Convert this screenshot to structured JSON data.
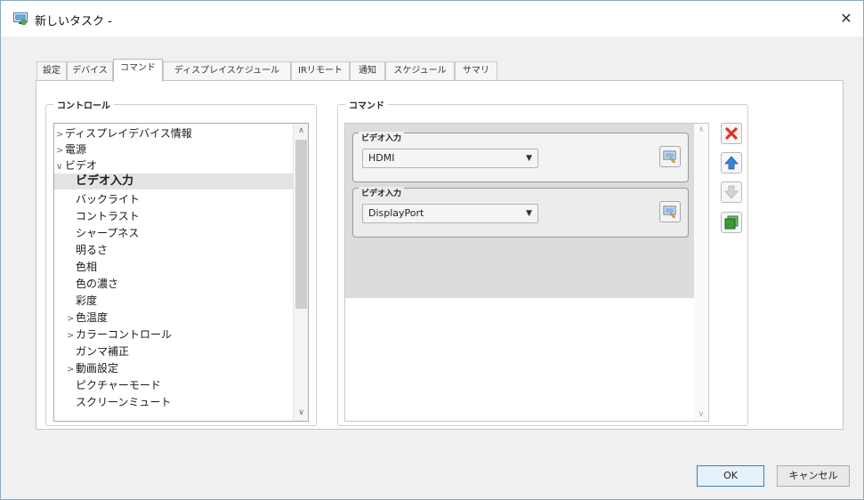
{
  "window": {
    "title": "新しいタスク -",
    "close_glyph": "✕"
  },
  "tabs": [
    {
      "label": "設定"
    },
    {
      "label": "デバイス"
    },
    {
      "label": "コマンド"
    },
    {
      "label": "ディスプレイスケジュール"
    },
    {
      "label": "IRリモート"
    },
    {
      "label": "通知"
    },
    {
      "label": "スケジュール"
    },
    {
      "label": "サマリ"
    }
  ],
  "active_tab_index": 2,
  "control_group": {
    "title": "コントロール",
    "items": [
      {
        "label": "ディスプレイデバイス情報",
        "caret": ">",
        "level": 0
      },
      {
        "label": "電源",
        "caret": ">",
        "level": 0
      },
      {
        "label": "ビデオ",
        "caret": "∨",
        "level": 0
      },
      {
        "label": "ビデオ入力",
        "caret": "",
        "level": 1,
        "selected": true
      },
      {
        "label": "バックライト",
        "caret": "",
        "level": 1
      },
      {
        "label": "コントラスト",
        "caret": "",
        "level": 1
      },
      {
        "label": "シャープネス",
        "caret": "",
        "level": 1
      },
      {
        "label": "明るさ",
        "caret": "",
        "level": 1
      },
      {
        "label": "色相",
        "caret": "",
        "level": 1
      },
      {
        "label": "色の濃さ",
        "caret": "",
        "level": 1
      },
      {
        "label": "彩度",
        "caret": "",
        "level": 1
      },
      {
        "label": "色温度",
        "caret": ">",
        "level": 1
      },
      {
        "label": "カラーコントロール",
        "caret": ">",
        "level": 1
      },
      {
        "label": "ガンマ補正",
        "caret": "",
        "level": 1
      },
      {
        "label": "動画設定",
        "caret": ">",
        "level": 1
      },
      {
        "label": "ピクチャーモード",
        "caret": "",
        "level": 1
      },
      {
        "label": "スクリーンミュート",
        "caret": "",
        "level": 1
      }
    ]
  },
  "command_group": {
    "title": "コマンド",
    "commands": [
      {
        "label": "ビデオ入力",
        "value": "HDMI"
      },
      {
        "label": "ビデオ入力",
        "value": "DisplayPort"
      }
    ]
  },
  "side_buttons": [
    {
      "icon": "delete-icon",
      "color": "#d9342b"
    },
    {
      "icon": "move-up-icon",
      "color": "#3b82d6"
    },
    {
      "icon": "move-down-icon",
      "color": "#c8c8c8"
    },
    {
      "icon": "duplicate-icon",
      "color": "#3a9a3a"
    }
  ],
  "footer": {
    "ok_label": "OK",
    "cancel_label": "キャンセル"
  },
  "colors": {
    "accent": "#3c7fb1",
    "selection": "#e3e3e3"
  }
}
